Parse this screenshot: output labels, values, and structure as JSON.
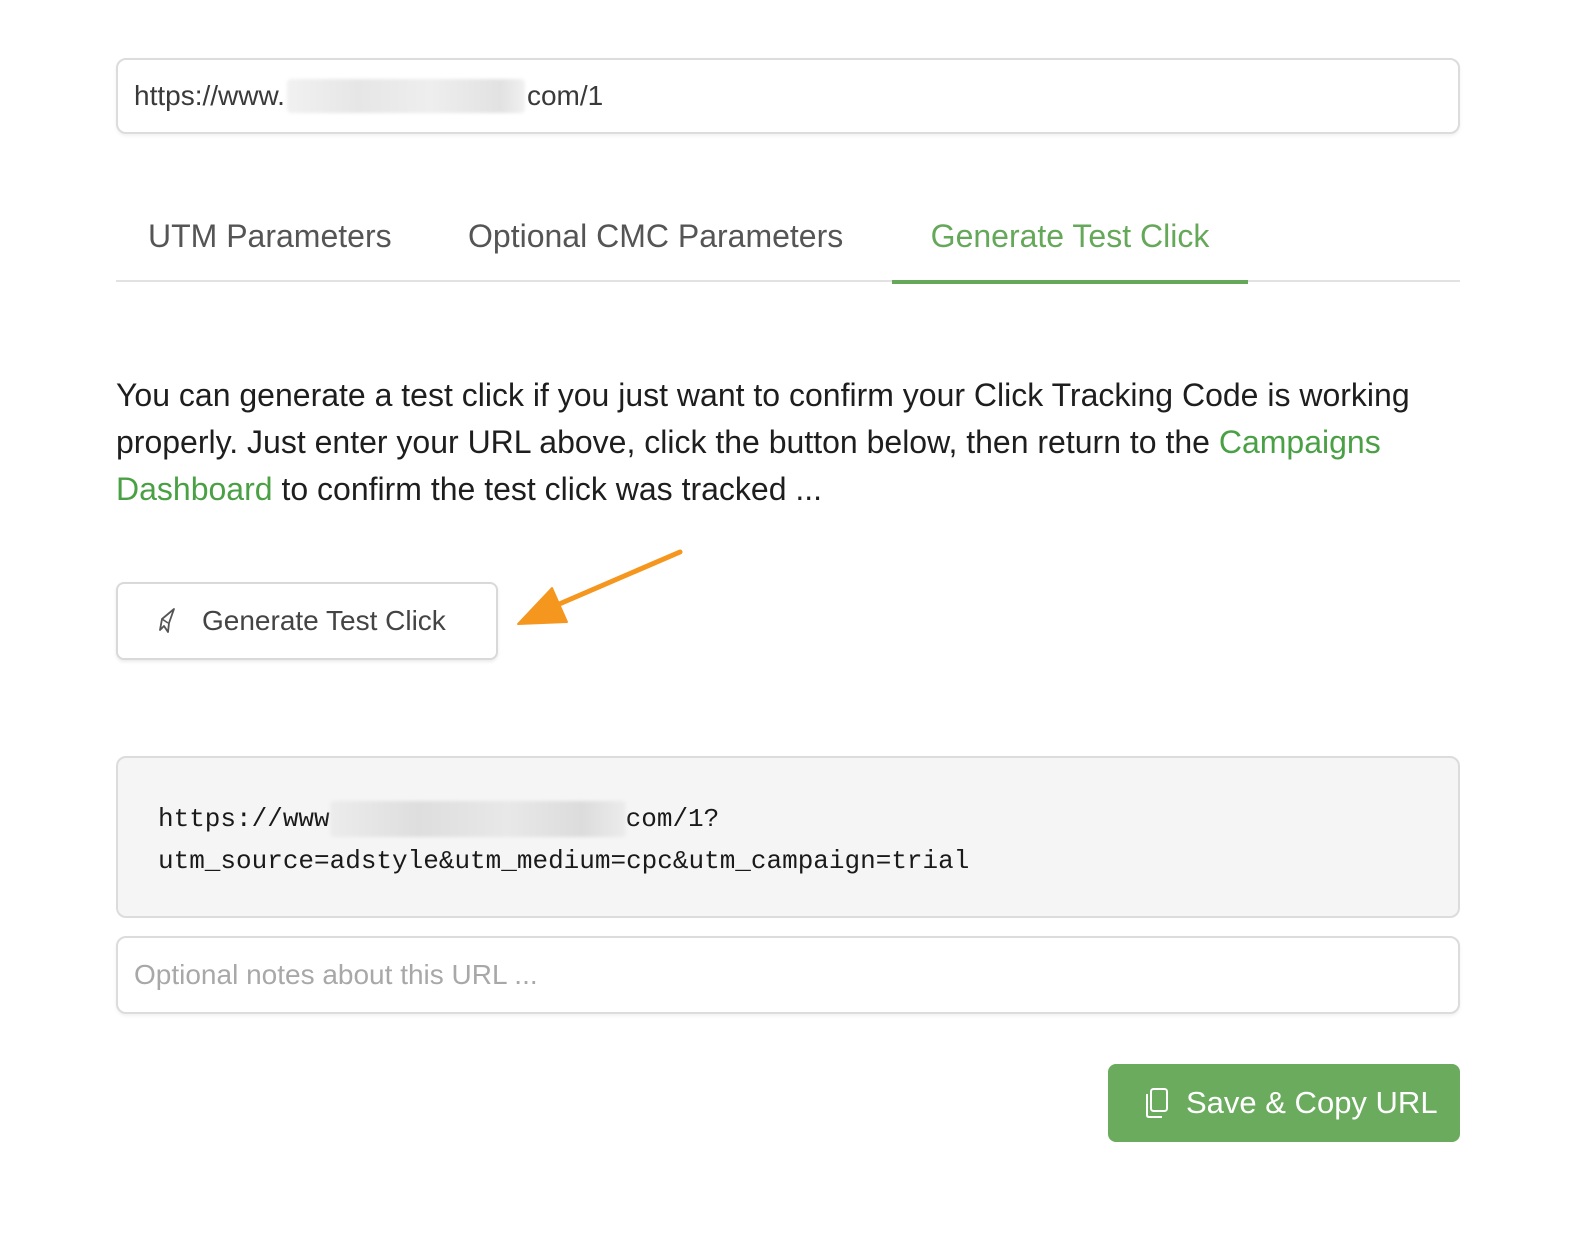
{
  "url_input": {
    "prefix": "https://www.",
    "suffix": "com/1"
  },
  "tabs": [
    {
      "label": "UTM Parameters",
      "active": false
    },
    {
      "label": "Optional CMC Parameters",
      "active": false
    },
    {
      "label": "Generate Test Click",
      "active": true
    }
  ],
  "description": {
    "text_before": "You can generate a test click if you just want to confirm your Click Tracking Code is working properly. Just enter your URL above, click the button below, then return to the ",
    "link": "Campaigns Dashboard",
    "text_after": " to confirm the test click was tracked ..."
  },
  "generate_button": {
    "label": "Generate Test Click",
    "icon": "rocket-icon"
  },
  "generated_url": {
    "line1_prefix": "https://www",
    "line1_suffix": "com/1?",
    "line2": "utm_source=adstyle&utm_medium=cpc&utm_campaign=trial"
  },
  "notes": {
    "placeholder": "Optional notes about this URL ...",
    "value": ""
  },
  "save_button": {
    "label": "Save & Copy URL",
    "icon": "copy-icon"
  },
  "colors": {
    "accent": "#65a85a",
    "button_green": "#6aab5e",
    "link": "#4aa044",
    "annotation_arrow": "#f5961e"
  }
}
